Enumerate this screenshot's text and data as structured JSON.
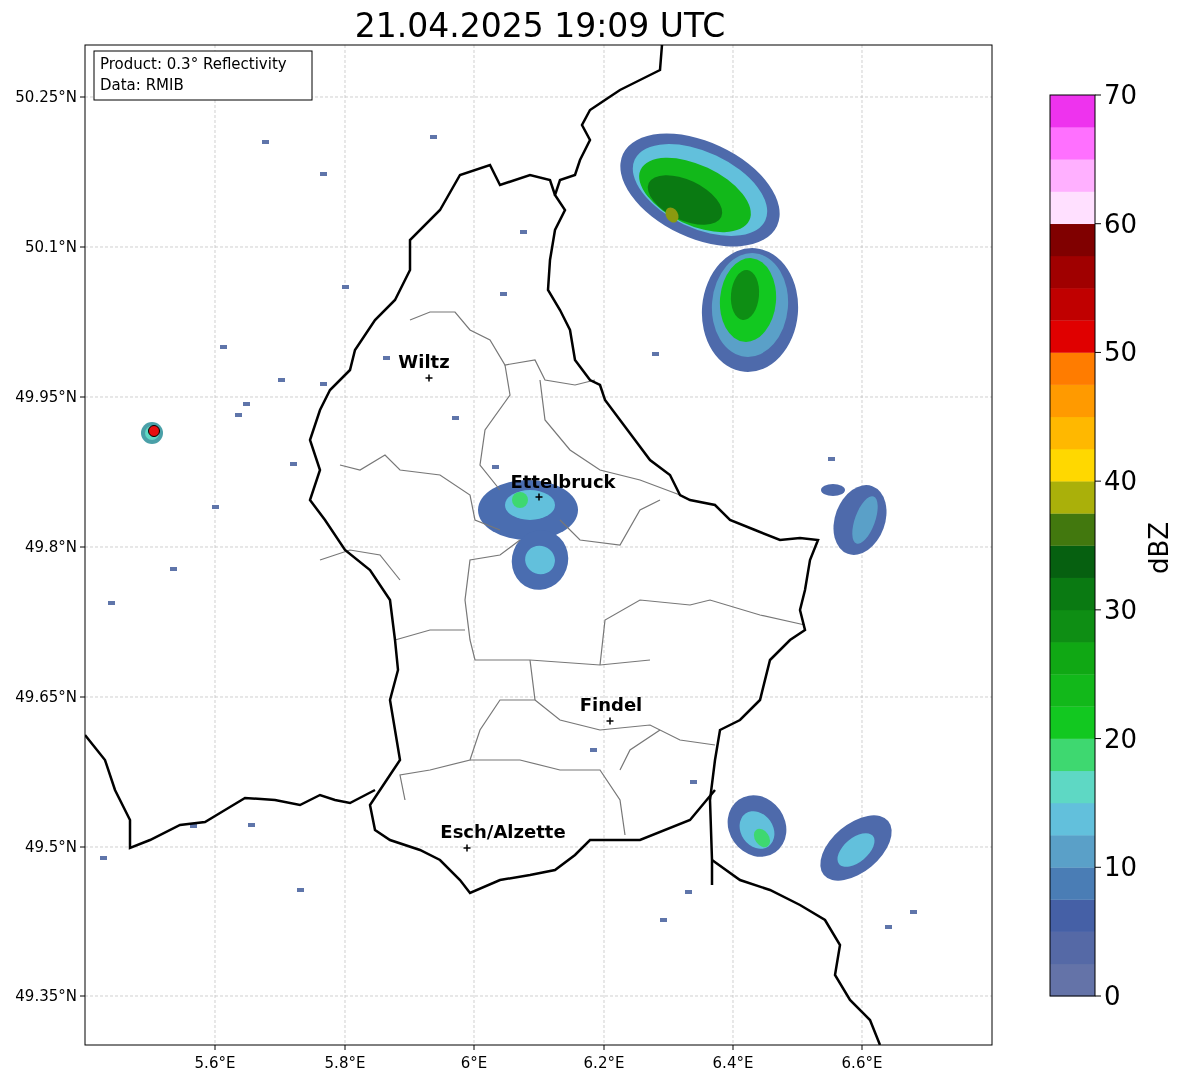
{
  "title": "21.04.2025 19:09 UTC",
  "info_box": [
    "Product: 0.3° Reflectivity",
    "Data: RMIB"
  ],
  "map": {
    "lat_ticks": [
      "50.25°N",
      "50.1°N",
      "49.95°N",
      "49.8°N",
      "49.65°N",
      "49.5°N",
      "49.35°N"
    ],
    "lon_ticks": [
      "5.6°E",
      "5.8°E",
      "6°E",
      "6.2°E",
      "6.4°E",
      "6.6°E"
    ],
    "cities": [
      {
        "name": "Wiltz"
      },
      {
        "name": "Ettelbruck"
      },
      {
        "name": "Findel"
      },
      {
        "name": "Esch/Alzette"
      }
    ]
  },
  "colorbar": {
    "label": "dBZ",
    "ticks": [
      "70",
      "60",
      "50",
      "40",
      "30",
      "20",
      "10",
      "0"
    ],
    "bins": [
      {
        "color": "#6473a8"
      },
      {
        "color": "#5569a6"
      },
      {
        "color": "#4560a6"
      },
      {
        "color": "#4a7db5"
      },
      {
        "color": "#5aa0c8"
      },
      {
        "color": "#62c0dc"
      },
      {
        "color": "#5ed8c4"
      },
      {
        "color": "#3ed870"
      },
      {
        "color": "#12c820"
      },
      {
        "color": "#12b81a"
      },
      {
        "color": "#10a814"
      },
      {
        "color": "#0e8e14"
      },
      {
        "color": "#0a7a12"
      },
      {
        "color": "#066010"
      },
      {
        "color": "#42780e"
      },
      {
        "color": "#aab00a"
      },
      {
        "color": "#ffd800"
      },
      {
        "color": "#ffb800"
      },
      {
        "color": "#ff9a00"
      },
      {
        "color": "#ff7c00"
      },
      {
        "color": "#e00000"
      },
      {
        "color": "#c00000"
      },
      {
        "color": "#a00000"
      },
      {
        "color": "#800000"
      },
      {
        "color": "#ffe0ff"
      },
      {
        "color": "#ffb0ff"
      },
      {
        "color": "#ff70ff"
      },
      {
        "color": "#ee33ee"
      }
    ]
  }
}
